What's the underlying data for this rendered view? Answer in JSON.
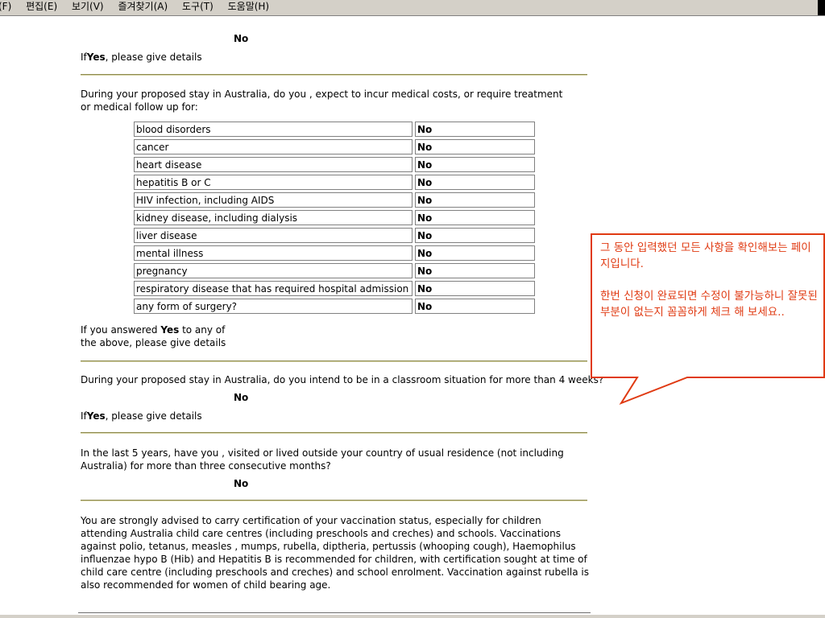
{
  "menubar": {
    "items": [
      "(F)",
      "편집(E)",
      "보기(V)",
      "즐겨찾기(A)",
      "도구(T)",
      "도움말(H)"
    ]
  },
  "q1": {
    "answer": "No",
    "details_prefix": "If",
    "details_bold": "Yes",
    "details_suffix": ", please give details"
  },
  "q2": {
    "question": "During your proposed stay in Australia, do you , expect to incur medical costs, or require treatment or medical follow up for:",
    "conditions": [
      {
        "label": "blood disorders",
        "value": "No"
      },
      {
        "label": "cancer",
        "value": "No"
      },
      {
        "label": "heart disease",
        "value": "No"
      },
      {
        "label": "hepatitis B or C",
        "value": "No"
      },
      {
        "label": "HIV infection, including AIDS",
        "value": "No"
      },
      {
        "label": "kidney disease, including dialysis",
        "value": "No"
      },
      {
        "label": "liver disease",
        "value": "No"
      },
      {
        "label": "mental illness",
        "value": "No"
      },
      {
        "label": "pregnancy",
        "value": "No"
      },
      {
        "label": "respiratory disease that has required hospital admission",
        "value": "No"
      },
      {
        "label": "any form of surgery?",
        "value": "No"
      }
    ],
    "followup_prefix": "If you answered",
    "followup_bold": "Yes",
    "followup_suffix": "to any of",
    "followup_line2": "the above, please give details"
  },
  "q3": {
    "question": "During your proposed stay in Australia, do you intend to be in a classroom situation for more than 4 weeks?",
    "answer": "No",
    "details_prefix": "If",
    "details_bold": "Yes",
    "details_suffix": ", please give details"
  },
  "q4": {
    "question": "In the last 5 years, have you , visited or lived outside your country of usual residence (not including Australia) for more than three consecutive months?",
    "answer": "No"
  },
  "advice": "You are strongly advised to carry certification of your vaccination status, especially for children attending Australia child care centres (including preschools and creches) and schools. Vaccinations against polio, tetanus, measles , mumps, rubella, diptheria, pertussis (whooping cough), Haemophilus influenzae hypo B (Hib) and Hepatitis B is recommended for children, with certification sought at time of child care centre (including preschools and creches) and school enrolment. Vaccination against rubella is also recommended for women of child bearing age.",
  "callout": {
    "line1": "그 동안 입력했던 모든 사항을 확인해보는 페이지입니다.",
    "line2": "한번 신청이 완료되면 수정이 불가능하니 잘못된 부분이 없는지 꼼꼼하게 체크 해 보세요..",
    "color": "#e03a12"
  }
}
